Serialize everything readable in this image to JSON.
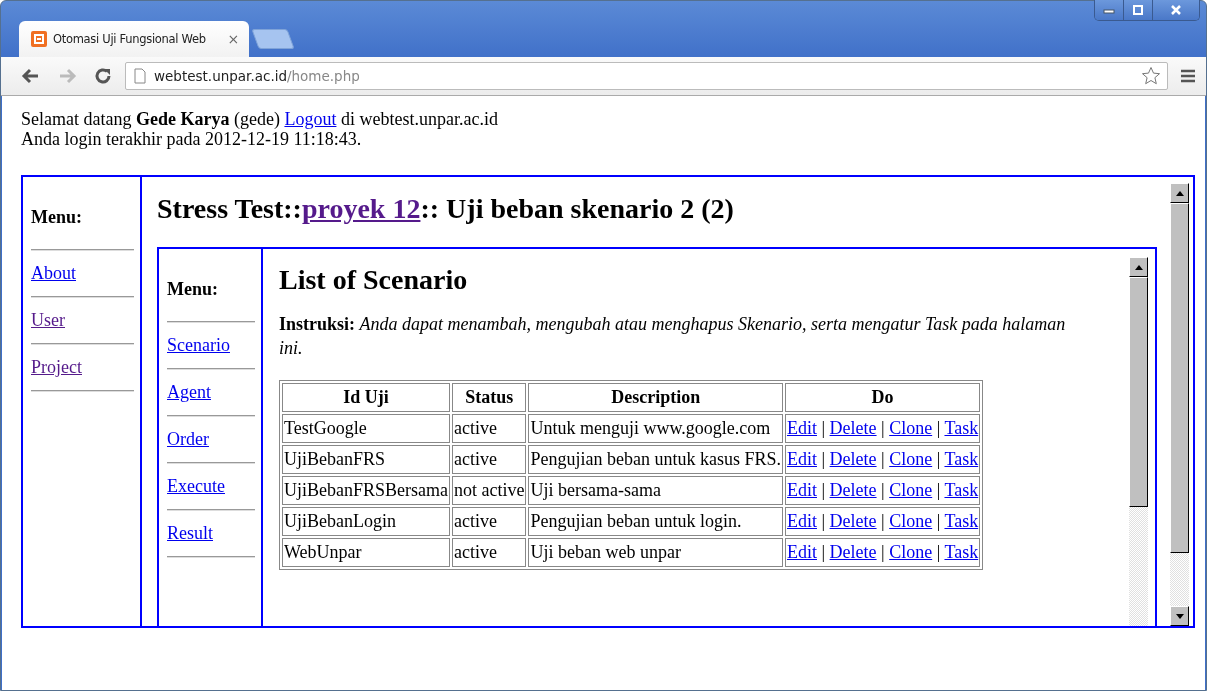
{
  "browser": {
    "tab": {
      "title": "Otomasi Uji Fungsional Web",
      "close": "×"
    },
    "address": {
      "host": "webtest.unpar.ac.id",
      "path": "/home.php"
    }
  },
  "header": {
    "welcome": "Selamat datang **Gede Karya** (gede)",
    "logout": "Logout",
    "site": "di webtest.unpar.ac.id",
    "last_login": "Anda login terakhir pada 2012-12-19 11:18:43."
  },
  "outer_menu": {
    "title": "Menu:",
    "items": [
      {
        "label": "About",
        "visited": false
      },
      {
        "label": "User",
        "visited": true
      },
      {
        "label": "Project",
        "visited": true
      }
    ]
  },
  "page_title": {
    "prefix": "Stress Test::",
    "link": "proyek 12",
    "suffix": ":: Uji beban skenario 2 (2)"
  },
  "inner_menu": {
    "title": "Menu:",
    "items": [
      {
        "label": "Scenario",
        "visited": false
      },
      {
        "label": "Agent",
        "visited": false
      },
      {
        "label": "Order",
        "visited": false
      },
      {
        "label": "Execute",
        "visited": false
      },
      {
        "label": "Result",
        "visited": false
      }
    ]
  },
  "content": {
    "heading": "List of Scenario",
    "instruction": "**Instruksi:** *Anda dapat menambah, mengubah atau menghapus Skenario, serta mengatur Task pada halaman ini.*"
  },
  "table": {
    "columns": [
      "Id Uji",
      "Status",
      "Description",
      "Do"
    ],
    "separator": "|",
    "rows": [
      {
        "cells": [
          "TestGoogle",
          "active",
          "Untuk menguji www.google.com"
        ],
        "actions": [
          "Edit",
          "Delete",
          "Clone",
          "Task"
        ]
      },
      {
        "cells": [
          "UjiBebanFRS",
          "active",
          "Pengujian beban untuk kasus FRS."
        ],
        "actions": [
          "Edit",
          "Delete",
          "Clone",
          "Task"
        ]
      },
      {
        "cells": [
          "UjiBebanFRSBersama",
          "not active",
          "Uji bersama-sama"
        ],
        "actions": [
          "Edit",
          "Delete",
          "Clone",
          "Task"
        ]
      },
      {
        "cells": [
          "UjiBebanLogin",
          "active",
          "Pengujian beban untuk login."
        ],
        "actions": [
          "Edit",
          "Delete",
          "Clone",
          "Task"
        ]
      },
      {
        "cells": [
          "WebUnpar",
          "active",
          "Uji beban web unpar"
        ],
        "actions": [
          "Edit",
          "Delete",
          "Clone",
          "Task"
        ]
      }
    ]
  }
}
